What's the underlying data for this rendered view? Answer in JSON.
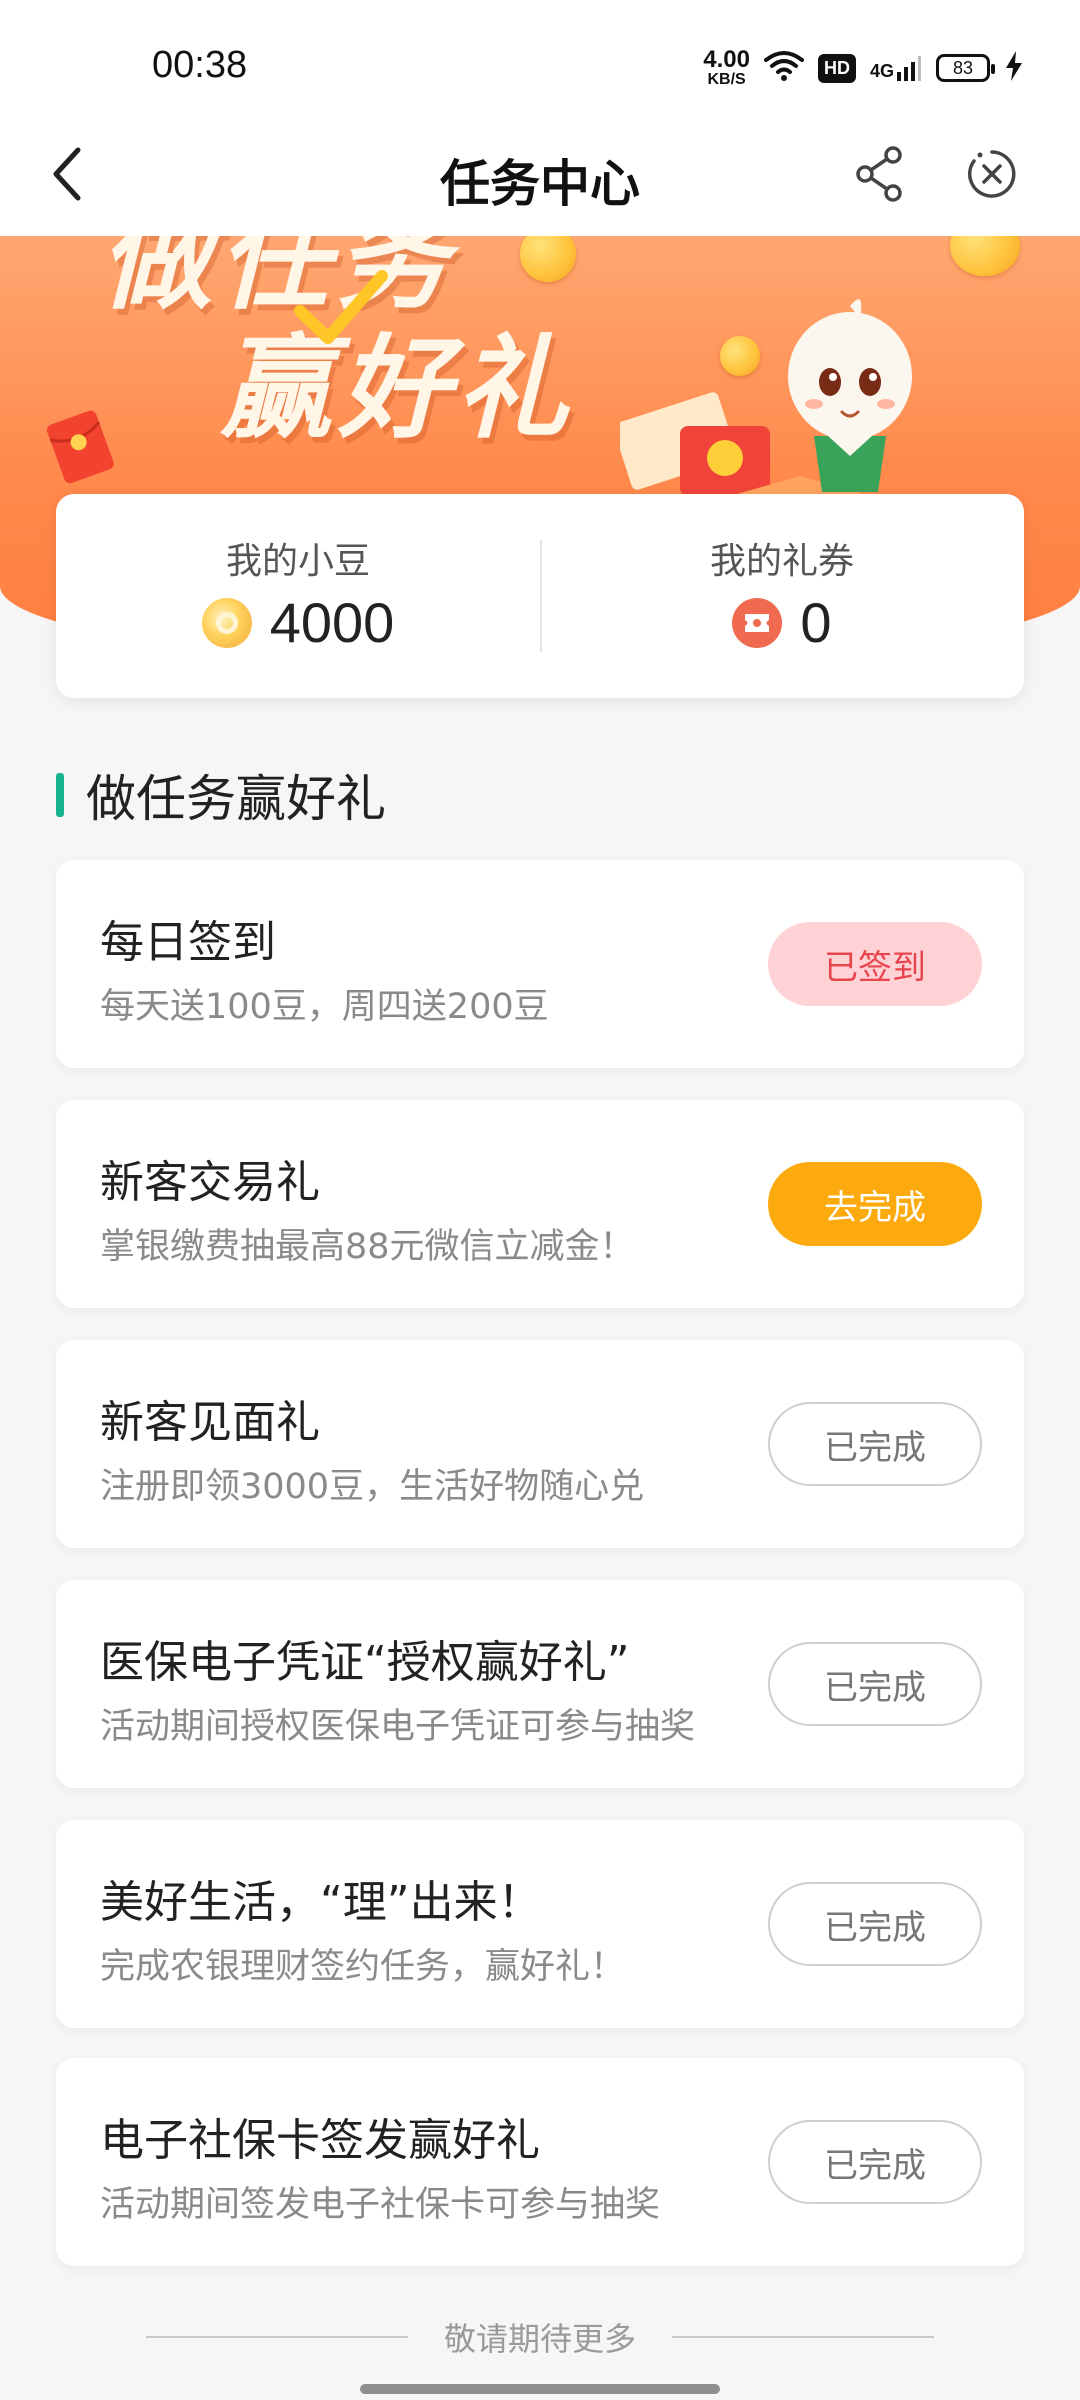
{
  "status_bar": {
    "time": "00:38",
    "net_speed_value": "4.00",
    "net_speed_unit": "KB/S",
    "hd": "HD",
    "signal": "4G",
    "battery": "83"
  },
  "nav": {
    "title": "任务中心",
    "icons": [
      "back-icon",
      "share-icon",
      "close-icon"
    ]
  },
  "banner": {
    "line1": "做任务",
    "line2": "赢好礼"
  },
  "stats": {
    "beans_label": "我的小豆",
    "beans_value": "4000",
    "coupons_label": "我的礼券",
    "coupons_value": "0"
  },
  "section": {
    "title": "做任务赢好礼",
    "accent_color": "#16b58e"
  },
  "tasks": [
    {
      "title": "每日签到",
      "desc": "每天送100豆，周四送200豆",
      "button": "已签到",
      "state": "signed"
    },
    {
      "title": "新客交易礼",
      "desc": "掌银缴费抽最高88元微信立减金！",
      "button": "去完成",
      "state": "todo"
    },
    {
      "title": "新客见面礼",
      "desc": "注册即领3000豆，生活好物随心兑",
      "button": "已完成",
      "state": "done"
    },
    {
      "title": "医保电子凭证“授权赢好礼”",
      "desc": "活动期间授权医保电子凭证可参与抽奖",
      "button": "已完成",
      "state": "done"
    },
    {
      "title": "美好生活，“理”出来！",
      "desc": "完成农银理财签约任务，赢好礼！",
      "button": "已完成",
      "state": "done"
    },
    {
      "title": "电子社保卡签发赢好礼",
      "desc": "活动期间签发电子社保卡可参与抽奖",
      "button": "已完成",
      "state": "done"
    }
  ],
  "footer": {
    "text": "敬请期待更多"
  },
  "colors": {
    "banner_orange": "#ff8a4c",
    "signed_bg": "#ffd2d6",
    "signed_text": "#e8454f",
    "todo_bg": "#fdaa0e"
  }
}
